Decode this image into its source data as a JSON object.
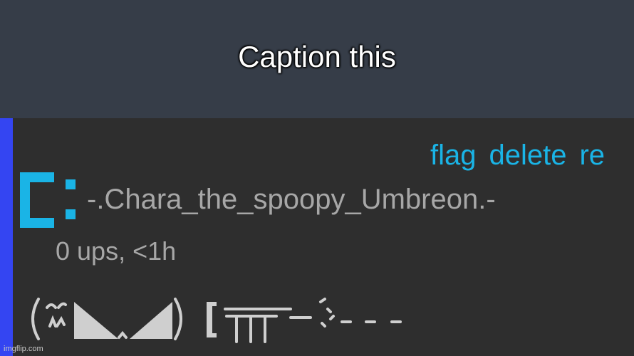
{
  "caption": {
    "text": "Caption this"
  },
  "comment": {
    "actions": [
      "flag",
      "delete",
      "re"
    ],
    "username": "-.Chara_the_spoopy_Umbreon.-",
    "meta": "0 ups, <1h"
  },
  "watermark": "imgflip.com",
  "colors": {
    "caption_bar": "#363d48",
    "comment_bg": "#2e2e2e",
    "accent_bar": "#3445f2",
    "link": "#1ab4e6",
    "muted_text": "#a7a7a7",
    "avatar": "#1ab4e6"
  }
}
